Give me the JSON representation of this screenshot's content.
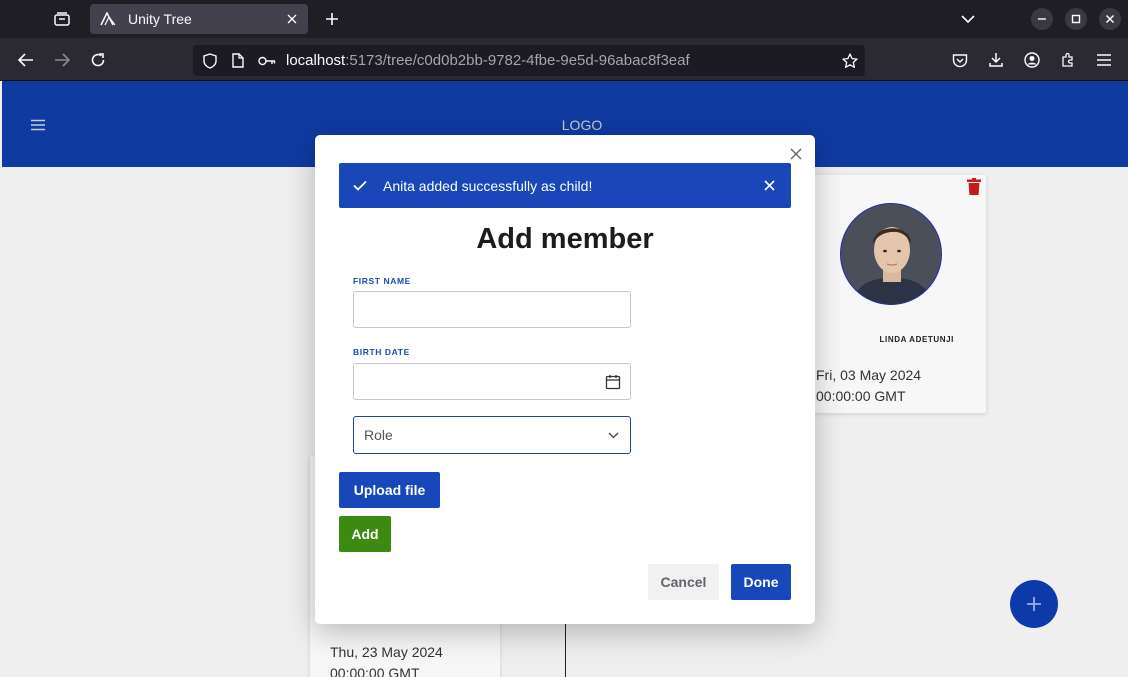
{
  "browser": {
    "tab_title": "Unity Tree",
    "url_host": "localhost",
    "url_path": ":5173/tree/c0d0b2bb-9782-4fbe-9e5d-96abac8f3eaf"
  },
  "app": {
    "logo": "LOGO"
  },
  "cards": {
    "right": {
      "name": "LINDA ADETUNJI",
      "date_line1": "Fri, 03 May 2024",
      "date_line2": "00:00:00 GMT"
    },
    "left": {
      "date_line1": "Thu, 23 May 2024",
      "date_line2": "00:00:00 GMT"
    }
  },
  "modal": {
    "toast": "Anita added successfully as child!",
    "title": "Add member",
    "first_name_label": "FIRST NAME",
    "first_name_value": "",
    "birth_date_label": "BIRTH DATE",
    "birth_date_value": "",
    "role_placeholder": "Role",
    "upload_label": "Upload file",
    "add_label": "Add",
    "cancel_label": "Cancel",
    "done_label": "Done"
  },
  "colors": {
    "appbar": "#0f3aa0",
    "primary": "#1747b8",
    "success": "#3c8a12",
    "danger": "#c41a1a"
  }
}
